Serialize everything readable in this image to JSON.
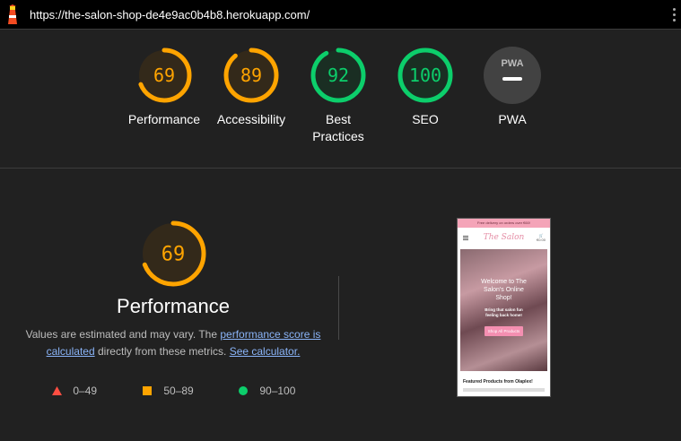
{
  "browser": {
    "url": "https://the-salon-shop-de4e9ac0b4b8.herokuapp.com/"
  },
  "colors": {
    "average": "#ffa400",
    "pass": "#0cce6b",
    "fail": "#ff4e42",
    "neutral": "#9e9e9e"
  },
  "gauges": [
    {
      "score": "69",
      "value": 69,
      "label": "Performance",
      "status": "average"
    },
    {
      "score": "89",
      "value": 89,
      "label": "Accessibility",
      "status": "average"
    },
    {
      "score": "92",
      "value": 92,
      "label": "Best Practices",
      "status": "pass"
    },
    {
      "score": "100",
      "value": 100,
      "label": "SEO",
      "status": "pass"
    },
    {
      "score": "PWA",
      "value": null,
      "label": "PWA",
      "status": "pwa"
    }
  ],
  "performance": {
    "score": "69",
    "value": 69,
    "title": "Performance",
    "desc_part1": "Values are estimated and may vary. The ",
    "desc_link1": "performance score is calculated",
    "desc_part2": " directly from these metrics. ",
    "desc_link2": "See calculator."
  },
  "legend": [
    {
      "range": "0–49",
      "shape": "triangle"
    },
    {
      "range": "50–89",
      "shape": "square"
    },
    {
      "range": "90–100",
      "shape": "circle"
    }
  ],
  "screenshot": {
    "banner": "Free delivery on orders over €60!",
    "logo": "The Salon",
    "cart": "€0.00",
    "hero_title": "Welcome to The Salon's Online Shop!",
    "hero_sub": "Bring that salon fun feeling back home!",
    "hero_button": "Shop All Products",
    "featured": "Featured Products from Olaplex!"
  }
}
